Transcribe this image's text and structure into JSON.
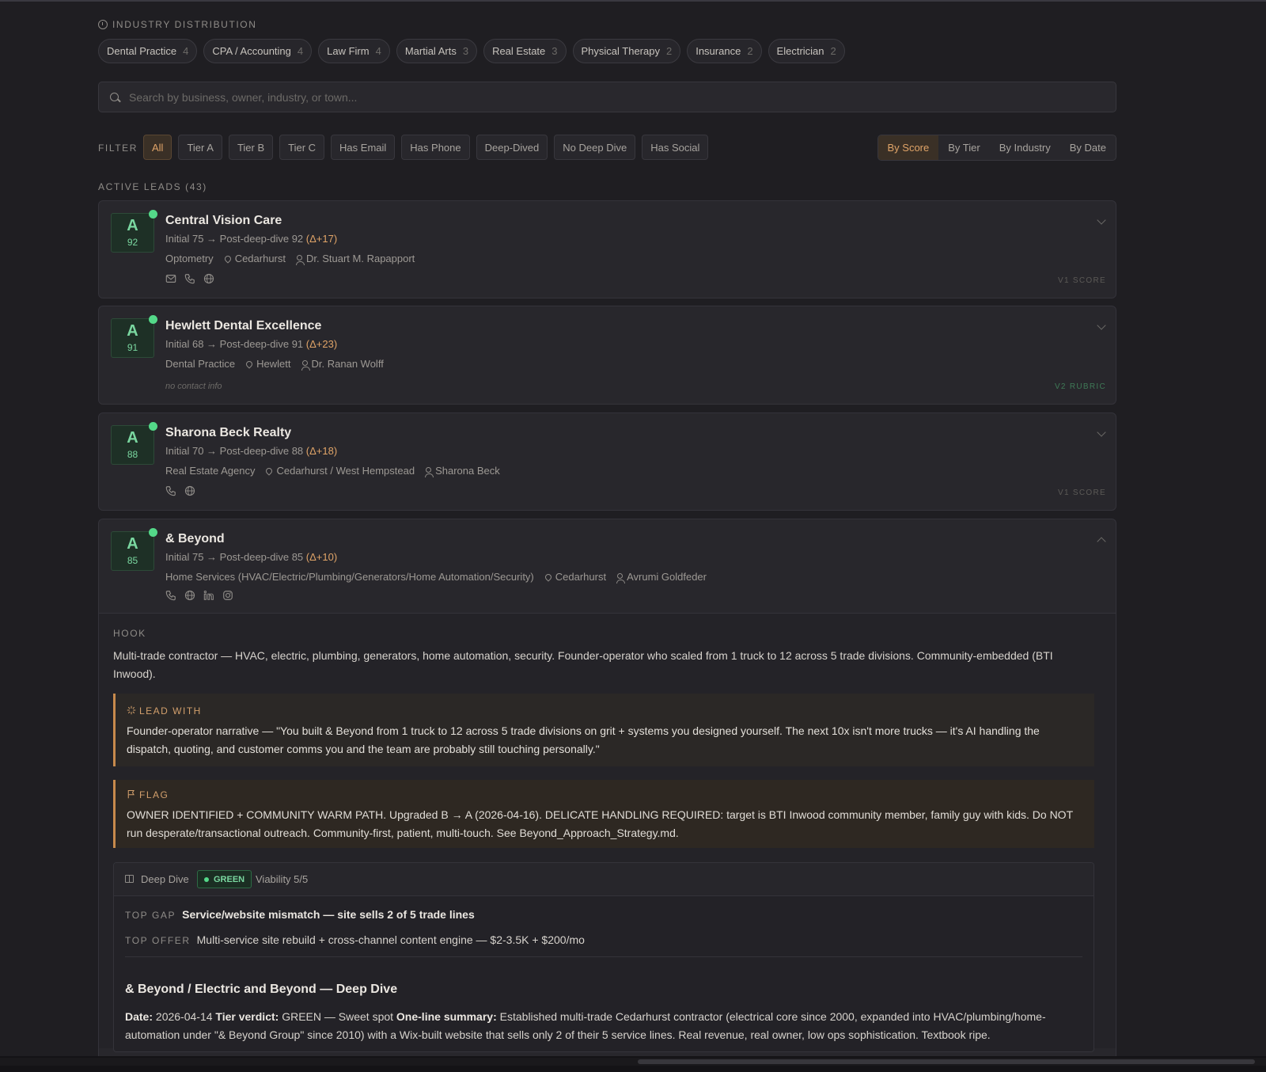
{
  "industry": {
    "label": "INDUSTRY DISTRIBUTION",
    "chips": [
      {
        "name": "Dental Practice",
        "count": "4"
      },
      {
        "name": "CPA / Accounting",
        "count": "4"
      },
      {
        "name": "Law Firm",
        "count": "4"
      },
      {
        "name": "Martial Arts",
        "count": "3"
      },
      {
        "name": "Real Estate",
        "count": "3"
      },
      {
        "name": "Physical Therapy",
        "count": "2"
      },
      {
        "name": "Insurance",
        "count": "2"
      },
      {
        "name": "Electrician",
        "count": "2"
      }
    ]
  },
  "search": {
    "placeholder": "Search by business, owner, industry, or town..."
  },
  "filter": {
    "label": "FILTER",
    "buttons": [
      "All",
      "Tier A",
      "Tier B",
      "Tier C",
      "Has Email",
      "Has Phone",
      "Deep-Dived",
      "No Deep Dive",
      "Has Social"
    ],
    "active": "All"
  },
  "sort": {
    "buttons": [
      "By Score",
      "By Tier",
      "By Industry",
      "By Date"
    ],
    "active": "By Score"
  },
  "leads_label": "ACTIVE LEADS (43)",
  "leads": [
    {
      "tier": "A",
      "score": "92",
      "name": "Central Vision Care",
      "score_line": "Initial 75 → Post-deep-dive 92",
      "delta": "(Δ+17)",
      "industry": "Optometry",
      "town": "Cedarhurst",
      "owner": "Dr. Stuart M. Rapapport",
      "version": "V1 SCORE"
    },
    {
      "tier": "A",
      "score": "91",
      "name": "Hewlett Dental Excellence",
      "score_line": "Initial 68 → Post-deep-dive 91",
      "delta": "(Δ+23)",
      "industry": "Dental Practice",
      "town": "Hewlett",
      "owner": "Dr. Ranan Wolff",
      "no_contact": "no contact info",
      "version": "V2 RUBRIC"
    },
    {
      "tier": "A",
      "score": "88",
      "name": "Sharona Beck Realty",
      "score_line": "Initial 70 → Post-deep-dive 88",
      "delta": "(Δ+18)",
      "industry": "Real Estate Agency",
      "town": "Cedarhurst / West Hempstead",
      "owner": "Sharona Beck",
      "version": "V1 SCORE"
    },
    {
      "tier": "A",
      "score": "85",
      "name": "& Beyond",
      "score_line": "Initial 75 → Post-deep-dive 85",
      "delta": "(Δ+10)",
      "industry": "Home Services (HVAC/Electric/Plumbing/Generators/Home Automation/Security)",
      "town": "Cedarhurst",
      "owner": "Avrumi Goldfeder"
    }
  ],
  "expanded": {
    "hook_label": "HOOK",
    "hook": "Multi-trade contractor — HVAC, electric, plumbing, generators, home automation, security. Founder-operator who scaled from 1 truck to 12 across 5 trade divisions. Community-embedded (BTI Inwood).",
    "lead_with_label": "LEAD WITH",
    "lead_with": "Founder-operator narrative — \"You built & Beyond from 1 truck to 12 across 5 trade divisions on grit + systems you designed yourself. The next 10x isn't more trucks — it's AI handling the dispatch, quoting, and customer comms you and the team are probably still touching personally.\"",
    "flag_label": "FLAG",
    "flag": "OWNER IDENTIFIED + COMMUNITY WARM PATH. Upgraded B → A (2026-04-16). DELICATE HANDLING REQUIRED: target is BTI Inwood community member, family guy with kids. Do NOT run desperate/transactional outreach. Community-first, patient, multi-touch. See Beyond_Approach_Strategy.md.",
    "deep_dive": {
      "title": "Deep Dive",
      "badge": "GREEN",
      "viability": "Viability 5/5",
      "top_gap_label": "TOP GAP",
      "top_gap": "Service/website mismatch — site sells 2 of 5 trade lines",
      "top_offer_label": "TOP OFFER",
      "top_offer": "Multi-service site rebuild + cross-channel content engine — $2-3.5K + $200/mo",
      "heading": "& Beyond / Electric and Beyond — Deep Dive",
      "date_label": "Date:",
      "date": "2026-04-14",
      "verdict_label": "Tier verdict:",
      "verdict": "GREEN — Sweet spot",
      "summary_label": "One-line summary:",
      "summary": "Established multi-trade Cedarhurst contractor (electrical core since 2000, expanded into HVAC/plumbing/home-automation under \"& Beyond Group\" since 2010) with a Wix-built website that sells only 2 of their 5 service lines. Real revenue, real owner, low ops sophistication. Textbook ripe."
    }
  },
  "colors": {
    "accent": "#e0a468",
    "tier_a": "#7ad7a0",
    "status_green": "#54d889"
  }
}
